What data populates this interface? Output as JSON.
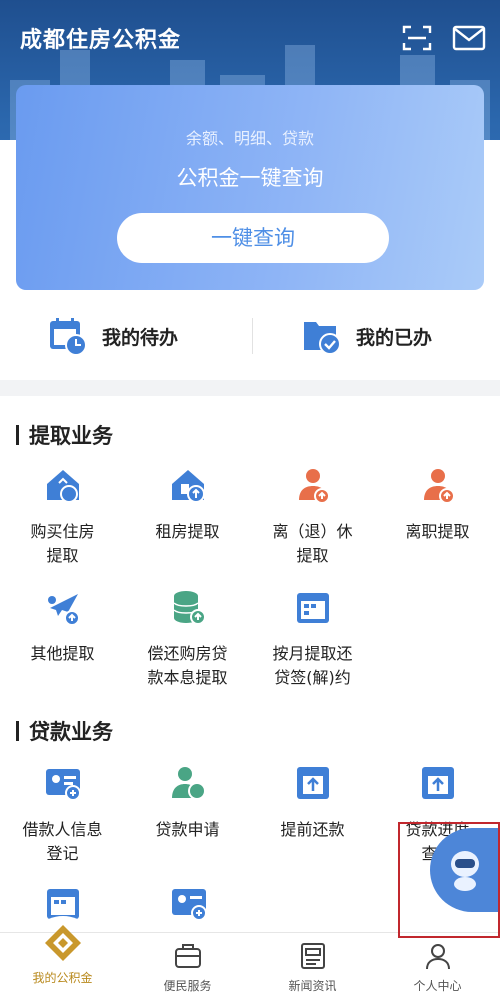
{
  "header": {
    "title": "成都住房公积金"
  },
  "query": {
    "subtitle": "余额、明细、贷款",
    "title": "公积金一键查询",
    "button": "一键查询"
  },
  "todo": {
    "pending": "我的待办",
    "done": "我的已办"
  },
  "withdraw": {
    "title": "提取业务",
    "items": [
      {
        "l1": "购买住房",
        "l2": "提取",
        "icon": "house-buy-icon"
      },
      {
        "l1": "租房提取",
        "l2": "",
        "icon": "house-rent-icon"
      },
      {
        "l1": "离（退）休",
        "l2": "提取",
        "icon": "retire-icon"
      },
      {
        "l1": "离职提取",
        "l2": "",
        "icon": "resign-icon"
      },
      {
        "l1": "其他提取",
        "l2": "",
        "icon": "other-withdraw-icon"
      },
      {
        "l1": "偿还购房贷",
        "l2": "款本息提取",
        "icon": "coins-icon"
      },
      {
        "l1": "按月提取还",
        "l2": "贷签(解)约",
        "icon": "calendar-icon"
      }
    ]
  },
  "loan": {
    "title": "贷款业务",
    "items": [
      {
        "l1": "借款人信息",
        "l2": "登记",
        "icon": "borrower-card-icon"
      },
      {
        "l1": "贷款申请",
        "l2": "",
        "icon": "loan-apply-icon"
      },
      {
        "l1": "提前还款",
        "l2": "",
        "icon": "prepay-icon"
      },
      {
        "l1": "贷款进度",
        "l2": "查询",
        "icon": "progress-query-icon"
      }
    ]
  },
  "tabs": [
    {
      "label": "我的公积金",
      "icon": "home-fund-icon"
    },
    {
      "label": "便民服务",
      "icon": "toolbox-icon"
    },
    {
      "label": "新闻资讯",
      "icon": "news-icon"
    },
    {
      "label": "个人中心",
      "icon": "user-icon"
    }
  ],
  "colors": {
    "accent": "#4f8fe6",
    "icon_blue": "#3f7fd6",
    "icon_orange": "#e86f4a",
    "tab_active": "#b98a1e",
    "highlight": "#c1272d"
  }
}
